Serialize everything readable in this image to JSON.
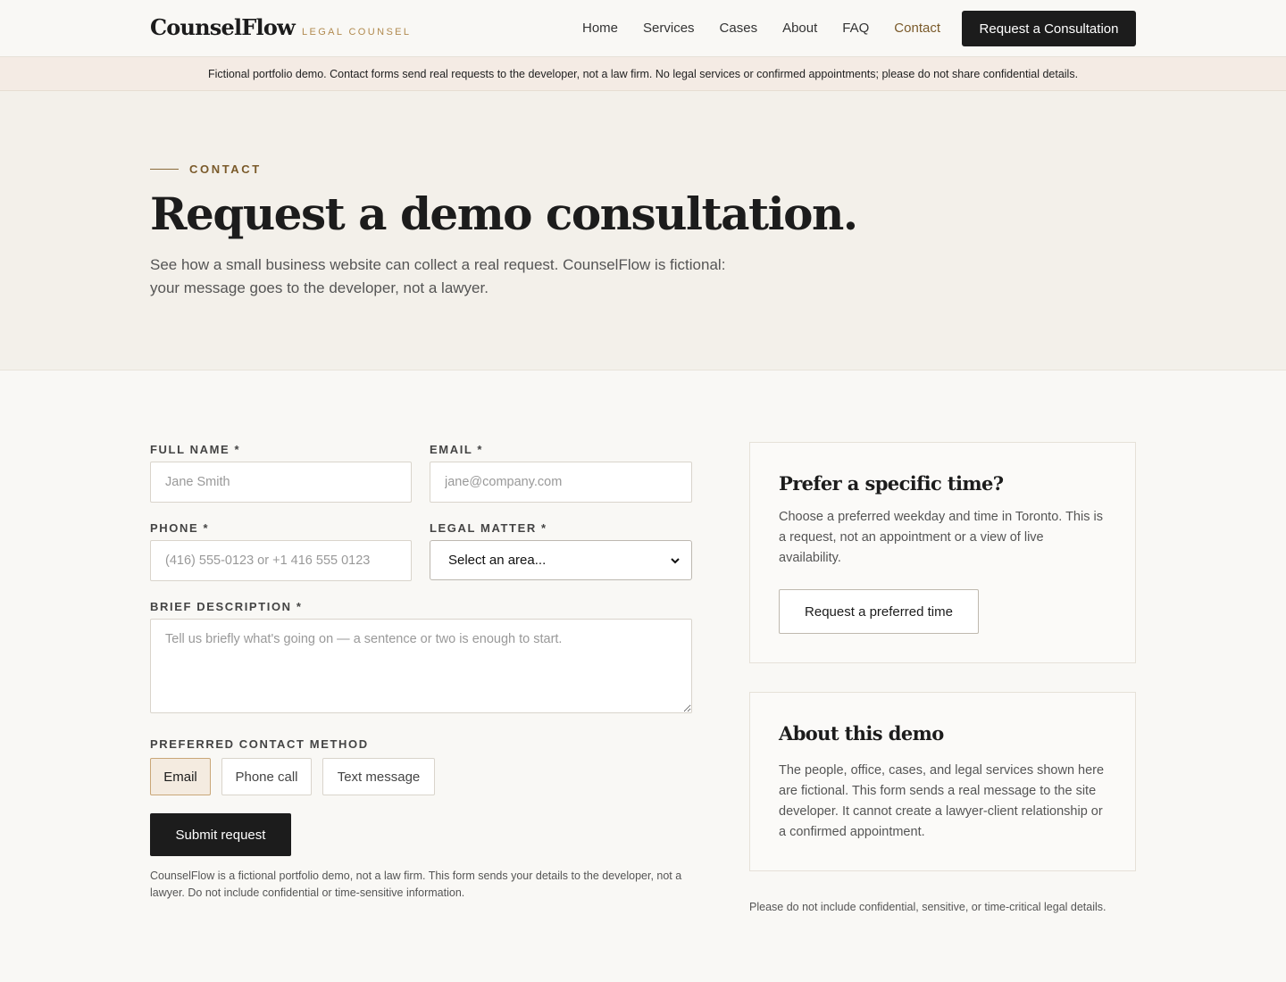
{
  "header": {
    "logo": "CounselFlow",
    "tagline": "LEGAL COUNSEL",
    "nav": [
      "Home",
      "Services",
      "Cases",
      "About",
      "FAQ",
      "Contact"
    ],
    "active_nav": "Contact",
    "cta_label": "Request a Consultation"
  },
  "banner": {
    "text": "Fictional portfolio demo. Contact forms send real requests to the developer, not a law firm. No legal services or confirmed appointments; please do not share confidential details."
  },
  "hero": {
    "eyebrow": "CONTACT",
    "title": "Request a demo consultation.",
    "subtitle": "See how a small business website can collect a real request. CounselFlow is fictional: your message goes to the developer, not a lawyer."
  },
  "form": {
    "full_name": {
      "label": "FULL NAME *",
      "placeholder": "Jane Smith"
    },
    "email": {
      "label": "EMAIL *",
      "placeholder": "jane@company.com"
    },
    "phone": {
      "label": "PHONE *",
      "placeholder": "(416) 555-0123 or +1 416 555 0123"
    },
    "matter": {
      "label": "LEGAL MATTER *",
      "selected": "Select an area..."
    },
    "description": {
      "label": "BRIEF DESCRIPTION *",
      "placeholder": "Tell us briefly what's going on — a sentence or two is enough to start."
    },
    "contact_method": {
      "label": "PREFERRED CONTACT METHOD",
      "options": [
        "Email",
        "Phone call",
        "Text message"
      ],
      "selected": "Email"
    },
    "submit_label": "Submit request",
    "disclaimer": "CounselFlow is a fictional portfolio demo, not a law firm. This form sends your details to the developer, not a lawyer. Do not include confidential or time-sensitive information."
  },
  "sidebar": {
    "time_card": {
      "title": "Prefer a specific time?",
      "body": "Choose a preferred weekday and time in Toronto. This is a request, not an appointment or a view of live availability.",
      "button": "Request a preferred time"
    },
    "about_card": {
      "title": "About this demo",
      "body": "The people, office, cases, and legal services shown here are fictional. This form sends a real message to the site developer. It cannot create a lawyer-client relationship or a confirmed appointment."
    },
    "note": "Please do not include confidential, sensitive, or time-critical legal details."
  },
  "icons": {
    "select_caret": "chevron-down-icon"
  },
  "colors": {
    "accent": "#7a5a2a",
    "gold": "#b18a4f",
    "dark": "#1c1c1c",
    "banner_bg": "#f4ebe4",
    "hero_bg": "#f3f0ea"
  }
}
